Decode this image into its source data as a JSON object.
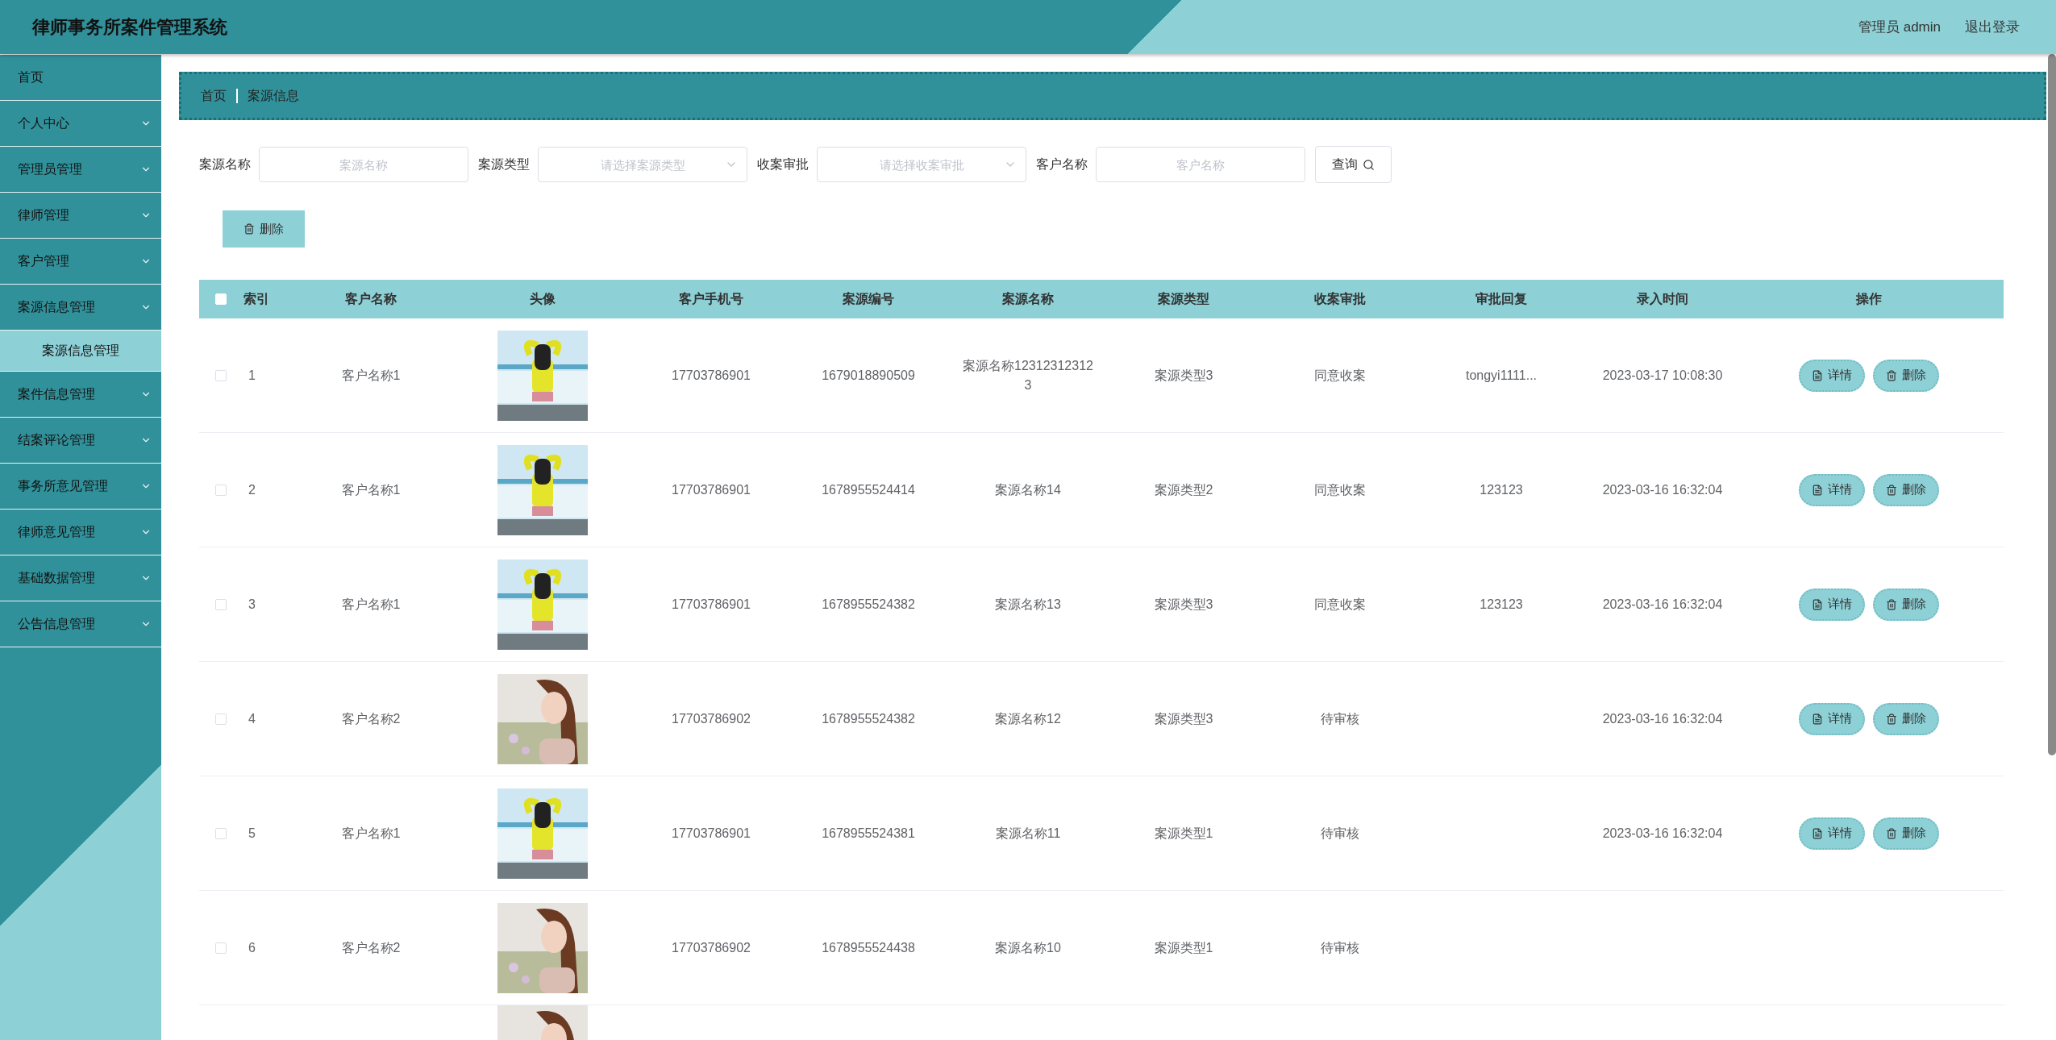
{
  "header": {
    "title": "律师事务所案件管理系统",
    "user": "管理员 admin",
    "logout": "退出登录"
  },
  "sidebar": {
    "items": [
      {
        "label": "首页",
        "kind": "link"
      },
      {
        "label": "个人中心",
        "kind": "group"
      },
      {
        "label": "管理员管理",
        "kind": "group"
      },
      {
        "label": "律师管理",
        "kind": "group"
      },
      {
        "label": "客户管理",
        "kind": "group"
      },
      {
        "label": "案源信息管理",
        "kind": "group",
        "children": [
          {
            "label": "案源信息管理",
            "selected": true
          }
        ]
      },
      {
        "label": "案件信息管理",
        "kind": "group"
      },
      {
        "label": "结案评论管理",
        "kind": "group"
      },
      {
        "label": "事务所意见管理",
        "kind": "group"
      },
      {
        "label": "律师意见管理",
        "kind": "group"
      },
      {
        "label": "基础数据管理",
        "kind": "group"
      },
      {
        "label": "公告信息管理",
        "kind": "group"
      }
    ]
  },
  "breadcrumb": [
    "首页",
    "案源信息"
  ],
  "filters": [
    {
      "kind": "input",
      "label": "案源名称",
      "placeholder": "案源名称"
    },
    {
      "kind": "select",
      "label": "案源类型",
      "placeholder": "请选择案源类型"
    },
    {
      "kind": "select",
      "label": "收案审批",
      "placeholder": "请选择收案审批"
    },
    {
      "kind": "input",
      "label": "客户名称",
      "placeholder": "客户名称"
    }
  ],
  "search_button": "查询",
  "bulk_delete_button": "删除",
  "table": {
    "select_all_checked": false,
    "columns": [
      "索引",
      "客户名称",
      "头像",
      "客户手机号",
      "案源编号",
      "案源名称",
      "案源类型",
      "收案审批",
      "审批回复",
      "录入时间",
      "操作"
    ],
    "rows": [
      {
        "checked": false,
        "index": "1",
        "customer": "客户名称1",
        "avatar": {
          "kind": "picture"
        },
        "phone": "17703786901",
        "code": "1679018890509",
        "name": "案源名称123123123123",
        "type": "案源类型3",
        "approval": "同意收案",
        "reply": "tongyi1111...",
        "time": "2023-03-17 10:08:30",
        "actions": [
          "详情",
          "删除"
        ]
      },
      {
        "checked": false,
        "index": "2",
        "customer": "客户名称1",
        "avatar": {
          "kind": "picture"
        },
        "phone": "17703786901",
        "code": "1678955524414",
        "name": "案源名称14",
        "type": "案源类型2",
        "approval": "同意收案",
        "reply": "123123",
        "time": "2023-03-16 16:32:04",
        "actions": [
          "详情",
          "删除"
        ]
      },
      {
        "checked": false,
        "index": "3",
        "customer": "客户名称1",
        "avatar": {
          "kind": "picture"
        },
        "phone": "17703786901",
        "code": "1678955524382",
        "name": "案源名称13",
        "type": "案源类型3",
        "approval": "同意收案",
        "reply": "123123",
        "time": "2023-03-16 16:32:04",
        "actions": [
          "详情",
          "删除"
        ]
      },
      {
        "checked": false,
        "index": "4",
        "customer": "客户名称2",
        "avatar": {
          "kind": "picture"
        },
        "phone": "17703786902",
        "code": "1678955524382",
        "name": "案源名称12",
        "type": "案源类型3",
        "approval": "待审核",
        "time": "2023-03-16 16:32:04",
        "actions": [
          "详情",
          "删除"
        ]
      },
      {
        "checked": false,
        "index": "5",
        "customer": "客户名称1",
        "avatar": {
          "kind": "picture"
        },
        "phone": "17703786901",
        "code": "1678955524381",
        "name": "案源名称11",
        "type": "案源类型1",
        "approval": "待审核",
        "time": "2023-03-16 16:32:04",
        "actions": [
          "详情",
          "删除"
        ]
      },
      {
        "checked": false,
        "index": "6",
        "customer": "客户名称2",
        "avatar": {
          "kind": "picture"
        },
        "phone": "17703786902",
        "code": "1678955524438",
        "name": "案源名称10",
        "type": "案源类型1",
        "approval": "待审核"
      },
      {
        "avatar": {
          "kind": "picture"
        }
      }
    ]
  }
}
